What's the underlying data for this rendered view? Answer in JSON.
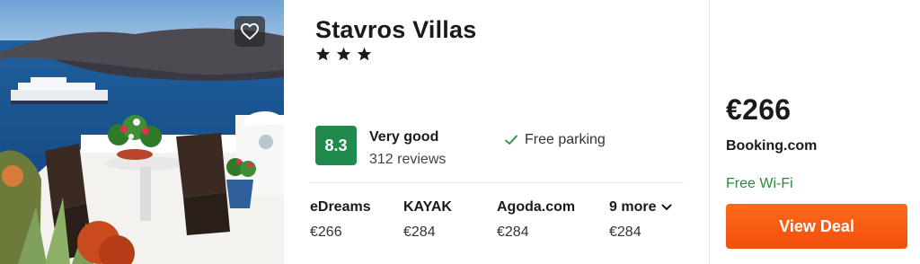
{
  "hotel": {
    "name": "Stavros Villas",
    "star_rating": 3,
    "star_icon": "star-icon",
    "favorite_icon": "heart-outline-icon"
  },
  "rating": {
    "score": "8.3",
    "word": "Very good",
    "reviews": "312 reviews",
    "badge_color": "#1f8a4c"
  },
  "amenity": {
    "label": "Free parking",
    "icon": "checkmark-icon"
  },
  "providers": [
    {
      "name": "eDreams",
      "price": "€266"
    },
    {
      "name": "KAYAK",
      "price": "€284"
    },
    {
      "name": "Agoda.com",
      "price": "€284"
    },
    {
      "name": "9 more",
      "price": "€284",
      "icon": "chevron-down-icon"
    }
  ],
  "deal": {
    "price": "€266",
    "provider": "Booking.com",
    "perk": "Free Wi-Fi",
    "button_label": "View Deal",
    "button_color": "#f24e0c",
    "perk_color": "#2a8a3e"
  }
}
